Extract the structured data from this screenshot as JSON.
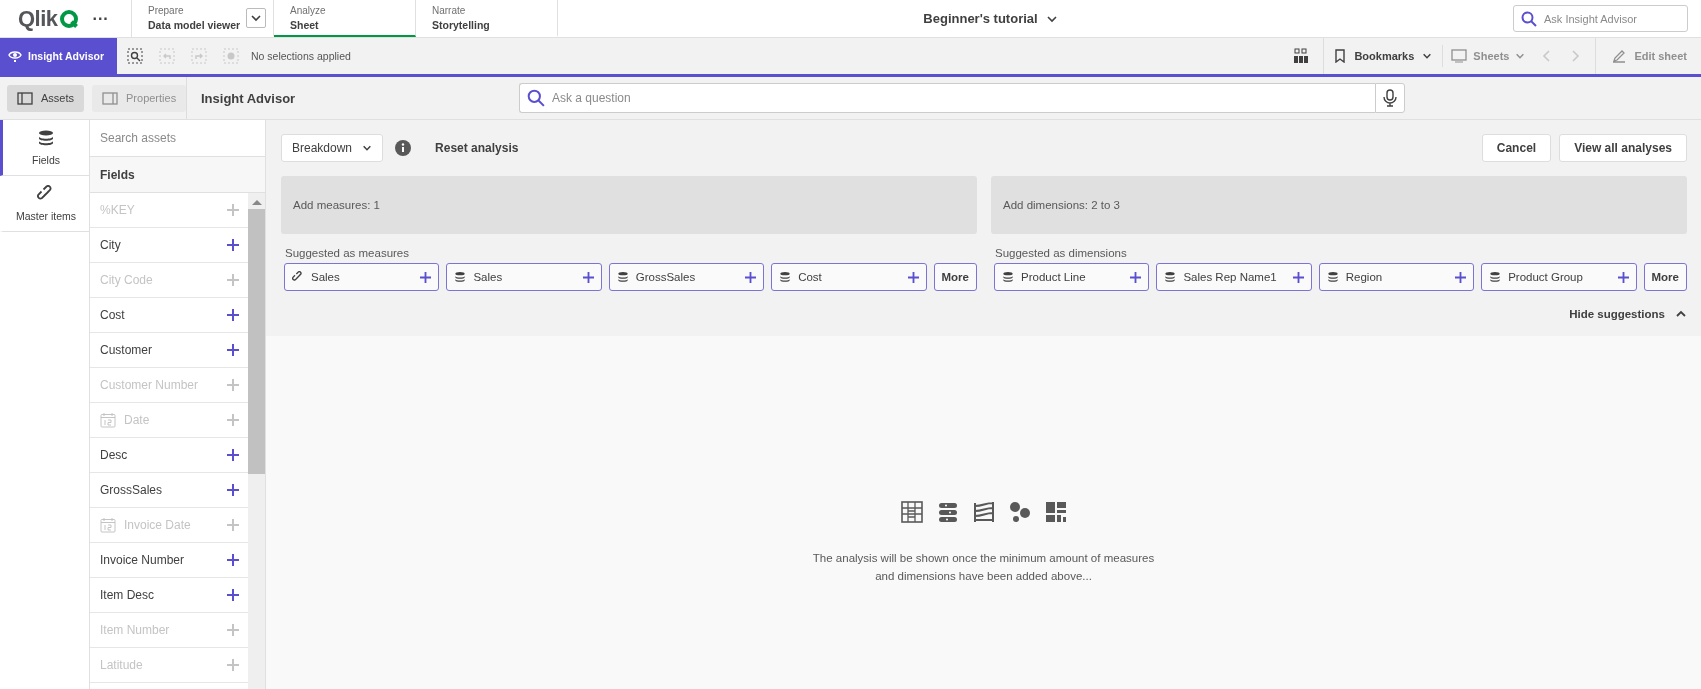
{
  "app_bar": {
    "logo": "Qlik",
    "more": "···",
    "tabs": [
      {
        "label": "Prepare",
        "value": "Data model viewer",
        "selected": false,
        "dropdown": true
      },
      {
        "label": "Analyze",
        "value": "Sheet",
        "selected": true,
        "dropdown": false
      },
      {
        "label": "Narrate",
        "value": "Storytelling",
        "selected": false,
        "dropdown": false
      }
    ],
    "app_title": "Beginner's tutorial",
    "search": {
      "placeholder": "Ask Insight Advisor"
    }
  },
  "toolbar": {
    "insight_button": "Insight Advisor",
    "selection_status": "No selections applied",
    "bookmarks": "Bookmarks",
    "sheets": {
      "label": "Sheets",
      "disabled": true
    },
    "edit_sheet": {
      "label": "Edit sheet",
      "disabled": true
    }
  },
  "panel_toggles": [
    {
      "label": "Assets",
      "selected": true,
      "disabled": false
    },
    {
      "label": "Properties",
      "selected": false,
      "disabled": true
    }
  ],
  "page_title": "Insight Advisor",
  "question": {
    "placeholder": "Ask a question"
  },
  "rail": [
    {
      "label": "Fields",
      "kind": "fields",
      "selected": true
    },
    {
      "label": "Master items",
      "kind": "link",
      "selected": false
    }
  ],
  "assets": {
    "search": {
      "placeholder": "Search assets"
    },
    "heading": "Fields",
    "fields": [
      {
        "name": "%KEY",
        "disabled": true,
        "kind": "text"
      },
      {
        "name": "City",
        "disabled": false,
        "kind": "text"
      },
      {
        "name": "City Code",
        "disabled": true,
        "kind": "text"
      },
      {
        "name": "Cost",
        "disabled": false,
        "kind": "text"
      },
      {
        "name": "Customer",
        "disabled": false,
        "kind": "text"
      },
      {
        "name": "Customer Number",
        "disabled": true,
        "kind": "text"
      },
      {
        "name": "Date",
        "disabled": true,
        "kind": "date"
      },
      {
        "name": "Desc",
        "disabled": false,
        "kind": "text"
      },
      {
        "name": "GrossSales",
        "disabled": false,
        "kind": "text"
      },
      {
        "name": "Invoice Date",
        "disabled": true,
        "kind": "date"
      },
      {
        "name": "Invoice Number",
        "disabled": false,
        "kind": "text"
      },
      {
        "name": "Item Desc",
        "disabled": false,
        "kind": "text"
      },
      {
        "name": "Item Number",
        "disabled": true,
        "kind": "text"
      },
      {
        "name": "Latitude",
        "disabled": true,
        "kind": "text"
      }
    ]
  },
  "analysis": {
    "type_select": "Breakdown",
    "reset": "Reset analysis",
    "buttons": [
      "Cancel",
      "View all analyses"
    ],
    "sections": [
      {
        "drop_zone": "Add measures: 1",
        "suggested_label": "Suggested as measures",
        "chips": [
          {
            "label": "Sales",
            "kind": "link"
          },
          {
            "label": "Sales",
            "kind": "field"
          },
          {
            "label": "GrossSales",
            "kind": "field"
          },
          {
            "label": "Cost",
            "kind": "field"
          }
        ],
        "more": "More"
      },
      {
        "drop_zone": "Add dimensions: 2 to 3",
        "suggested_label": "Suggested as dimensions",
        "chips": [
          {
            "label": "Product Line",
            "kind": "field"
          },
          {
            "label": "Sales Rep Name1",
            "kind": "field"
          },
          {
            "label": "Region",
            "kind": "field"
          },
          {
            "label": "Product Group",
            "kind": "field"
          }
        ],
        "more": "More"
      }
    ],
    "hide_suggestions": "Hide suggestions",
    "empty_message": "The analysis will be shown once the minimum amount of measures and dimensions have been added above..."
  }
}
